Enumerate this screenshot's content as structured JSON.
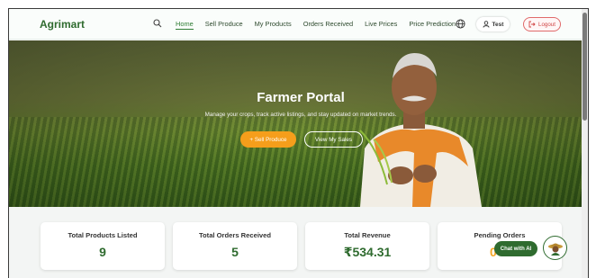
{
  "brand": "Agrimart",
  "nav": {
    "links": [
      {
        "label": "Home",
        "active": true
      },
      {
        "label": "Sell Produce"
      },
      {
        "label": "My Products"
      },
      {
        "label": "Orders Received"
      },
      {
        "label": "Live Prices"
      },
      {
        "label": "Price Prediction"
      }
    ],
    "user_label": "Test",
    "logout_label": "Logout"
  },
  "hero": {
    "title": "Farmer Portal",
    "subtitle": "Manage your crops, track active listings, and stay updated on market trends.",
    "primary_button": "+ Sell Produce",
    "secondary_button": "View My Sales"
  },
  "stats": [
    {
      "label": "Total Products Listed",
      "value": "9"
    },
    {
      "label": "Total Orders Received",
      "value": "5"
    },
    {
      "label": "Total Revenue",
      "value": "₹534.31"
    },
    {
      "label": "Pending Orders",
      "value": "0"
    }
  ],
  "chat": {
    "label": "Chat with AI"
  },
  "colors": {
    "brand_green": "#2f6b2f",
    "accent_orange": "#f59e1b",
    "logout_red": "#d04545"
  }
}
